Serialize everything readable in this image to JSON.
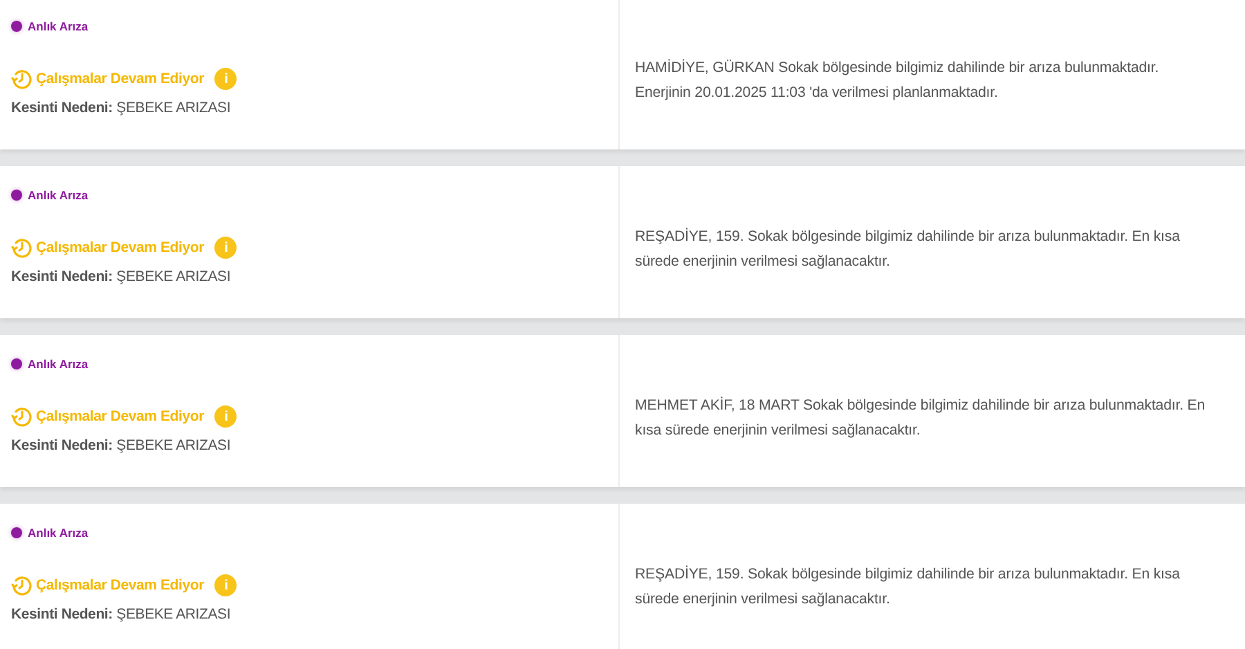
{
  "outages": [
    {
      "tag": "Anlık Arıza",
      "color": "#8e1a9e",
      "status": "Çalışmalar Devam Ediyor",
      "info_icon": "i",
      "reason_label": "Kesinti Nedeni:",
      "reason": "ŞEBEKE ARIZASI",
      "description": "HAMİDİYE, GÜRKAN Sokak bölgesinde bilgimiz dahilinde bir arıza bulunmaktadır. Enerjinin 20.01.2025 11:03 'da verilmesi planlanmaktadır."
    },
    {
      "tag": "Anlık Arıza",
      "color": "#8e1a9e",
      "status": "Çalışmalar Devam Ediyor",
      "info_icon": "i",
      "reason_label": "Kesinti Nedeni:",
      "reason": "ŞEBEKE ARIZASI",
      "description": "REŞADİYE, 159. Sokak bölgesinde bilgimiz dahilinde bir arıza bulunmaktadır. En kısa sürede enerjinin verilmesi sağlanacaktır."
    },
    {
      "tag": "Anlık Arıza",
      "color": "#8e1a9e",
      "status": "Çalışmalar Devam Ediyor",
      "info_icon": "i",
      "reason_label": "Kesinti Nedeni:",
      "reason": "ŞEBEKE ARIZASI",
      "description": "MEHMET AKİF, 18 MART Sokak bölgesinde bilgimiz dahilinde bir arıza bulunmaktadır. En kısa sürede enerjinin verilmesi sağlanacaktır."
    },
    {
      "tag": "Anlık Arıza",
      "color": "#8e1a9e",
      "status": "Çalışmalar Devam Ediyor",
      "info_icon": "i",
      "reason_label": "Kesinti Nedeni:",
      "reason": "ŞEBEKE ARIZASI",
      "description": "REŞADİYE, 159. Sokak bölgesinde bilgimiz dahilinde bir arıza bulunmaktadır. En kısa sürede enerjinin verilmesi sağlanacaktır."
    }
  ]
}
